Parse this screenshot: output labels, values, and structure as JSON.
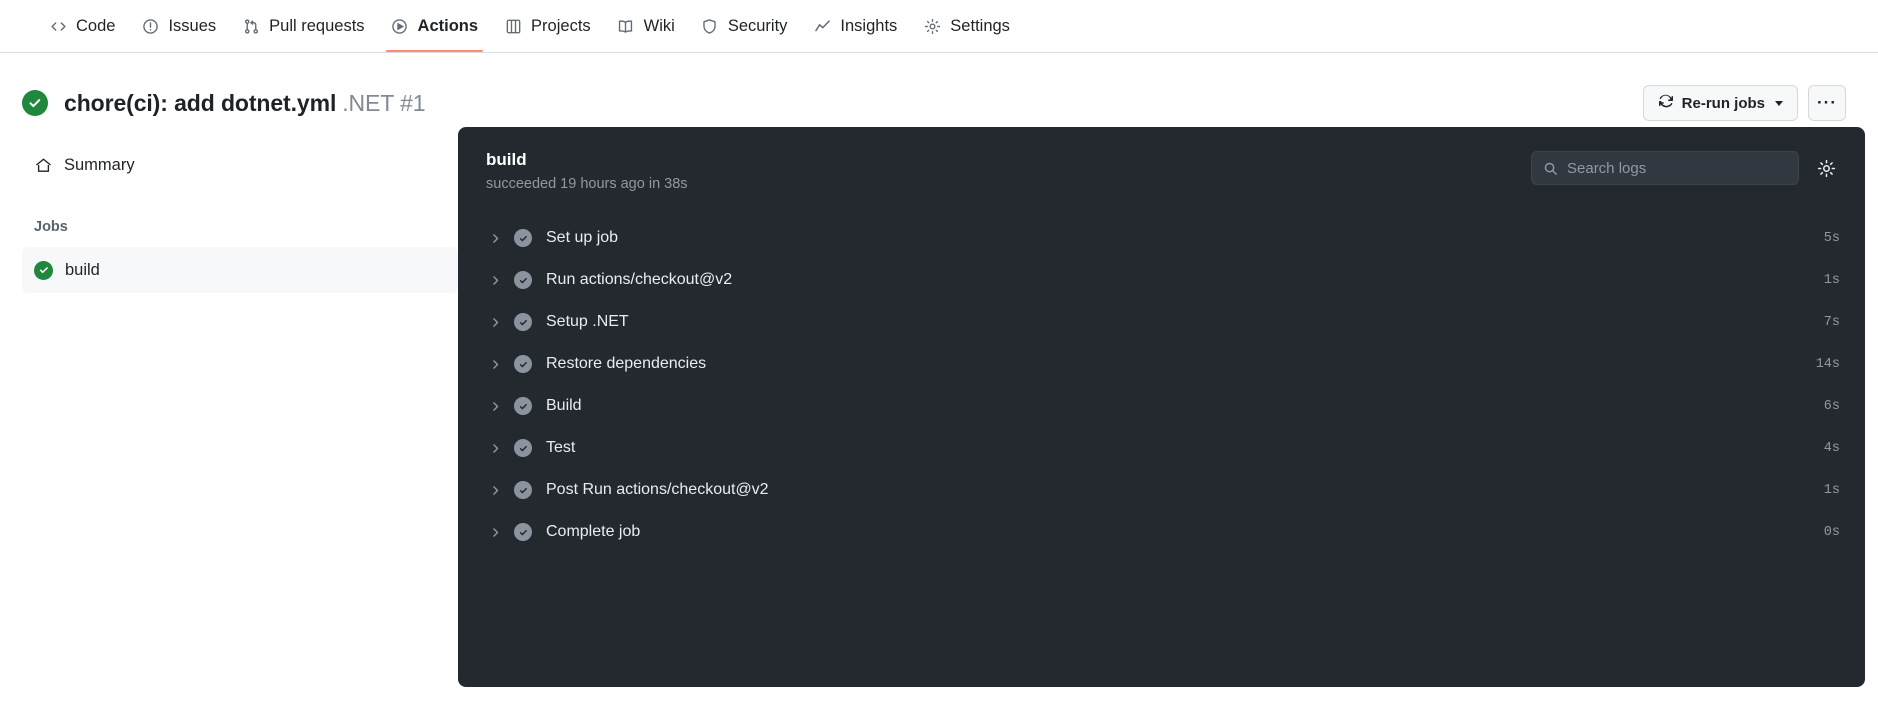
{
  "nav": {
    "items": [
      {
        "label": "Code",
        "icon": "code-icon",
        "active": false
      },
      {
        "label": "Issues",
        "icon": "issue-opened-icon",
        "active": false
      },
      {
        "label": "Pull requests",
        "icon": "git-pull-request-icon",
        "active": false
      },
      {
        "label": "Actions",
        "icon": "play-icon",
        "active": true
      },
      {
        "label": "Projects",
        "icon": "table-icon",
        "active": false
      },
      {
        "label": "Wiki",
        "icon": "book-icon",
        "active": false
      },
      {
        "label": "Security",
        "icon": "shield-icon",
        "active": false
      },
      {
        "label": "Insights",
        "icon": "graph-icon",
        "active": false
      },
      {
        "label": "Settings",
        "icon": "gear-icon",
        "active": false
      }
    ]
  },
  "header": {
    "status_icon": "check-circle-icon",
    "title": "chore(ci): add dotnet.yml",
    "subtitle": ".NET #1",
    "rerun_label": "Re-run jobs",
    "rerun_icon": "sync-icon",
    "kebab_label": "···"
  },
  "sidebar": {
    "summary_label": "Summary",
    "summary_icon": "home-icon",
    "jobs_title": "Jobs",
    "jobs": [
      {
        "name": "build",
        "status": "success",
        "selected": true
      }
    ]
  },
  "log_panel": {
    "job_name": "build",
    "job_status": "succeeded 19 hours ago in 38s",
    "search": {
      "placeholder": "Search logs",
      "value": "",
      "icon": "search-icon"
    },
    "settings_icon": "gear-icon",
    "steps": [
      {
        "name": "Set up job",
        "duration": "5s",
        "status": "success",
        "expanded": false
      },
      {
        "name": "Run actions/checkout@v2",
        "duration": "1s",
        "status": "success",
        "expanded": false
      },
      {
        "name": "Setup .NET",
        "duration": "7s",
        "status": "success",
        "expanded": false
      },
      {
        "name": "Restore dependencies",
        "duration": "14s",
        "status": "success",
        "expanded": false
      },
      {
        "name": "Build",
        "duration": "6s",
        "status": "success",
        "expanded": false
      },
      {
        "name": "Test",
        "duration": "4s",
        "status": "success",
        "expanded": false
      },
      {
        "name": "Post Run actions/checkout@v2",
        "duration": "1s",
        "status": "success",
        "expanded": false
      },
      {
        "name": "Complete job",
        "duration": "0s",
        "status": "success",
        "expanded": false
      }
    ]
  },
  "colors": {
    "success_green": "#1f883d",
    "active_tab_underline": "#fd8c73",
    "log_panel_bg": "#24292f",
    "step_check_gray": "#8b949e"
  }
}
